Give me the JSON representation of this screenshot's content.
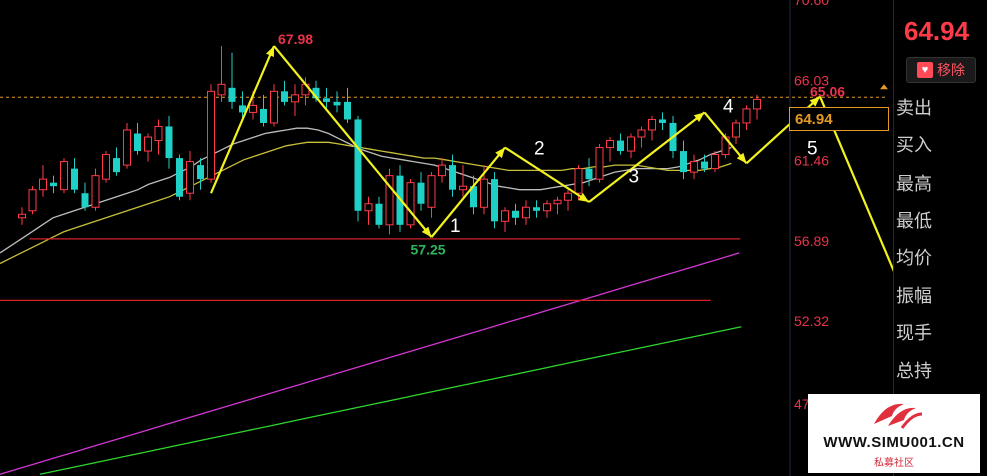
{
  "chart_data": {
    "type": "candlestick",
    "title": "",
    "y_axis_ticks": [
      "70.60",
      "66.03",
      "61.46",
      "56.89",
      "52.32",
      "47"
    ],
    "ylim": [
      43.5,
      70.6
    ],
    "current_price_line": 65.06,
    "candles": [
      {
        "o": 58.2,
        "h": 58.8,
        "l": 57.8,
        "c": 58.4
      },
      {
        "o": 58.6,
        "h": 60.0,
        "l": 58.4,
        "c": 59.8
      },
      {
        "o": 59.8,
        "h": 61.2,
        "l": 59.4,
        "c": 60.4
      },
      {
        "o": 60.2,
        "h": 60.6,
        "l": 59.6,
        "c": 60.0
      },
      {
        "o": 59.8,
        "h": 61.6,
        "l": 59.6,
        "c": 61.4
      },
      {
        "o": 61.0,
        "h": 61.6,
        "l": 59.6,
        "c": 59.8
      },
      {
        "o": 59.6,
        "h": 60.2,
        "l": 58.6,
        "c": 58.8
      },
      {
        "o": 58.8,
        "h": 61.0,
        "l": 58.6,
        "c": 60.6
      },
      {
        "o": 60.4,
        "h": 62.0,
        "l": 60.2,
        "c": 61.8
      },
      {
        "o": 61.6,
        "h": 62.2,
        "l": 60.6,
        "c": 60.8
      },
      {
        "o": 61.2,
        "h": 63.6,
        "l": 61.0,
        "c": 63.2
      },
      {
        "o": 63.0,
        "h": 63.6,
        "l": 61.8,
        "c": 62.0
      },
      {
        "o": 62.0,
        "h": 63.0,
        "l": 61.4,
        "c": 62.8
      },
      {
        "o": 62.6,
        "h": 63.8,
        "l": 61.8,
        "c": 63.4
      },
      {
        "o": 63.4,
        "h": 64.0,
        "l": 61.0,
        "c": 61.6
      },
      {
        "o": 61.6,
        "h": 61.8,
        "l": 59.2,
        "c": 59.4
      },
      {
        "o": 59.6,
        "h": 62.0,
        "l": 59.2,
        "c": 61.4
      },
      {
        "o": 61.2,
        "h": 61.6,
        "l": 59.8,
        "c": 60.4
      },
      {
        "o": 60.4,
        "h": 65.8,
        "l": 60.2,
        "c": 65.4
      },
      {
        "o": 65.2,
        "h": 67.98,
        "l": 64.8,
        "c": 65.8
      },
      {
        "o": 65.6,
        "h": 67.6,
        "l": 64.4,
        "c": 64.8
      },
      {
        "o": 64.6,
        "h": 65.4,
        "l": 63.8,
        "c": 64.2
      },
      {
        "o": 64.2,
        "h": 65.4,
        "l": 63.8,
        "c": 64.6
      },
      {
        "o": 64.4,
        "h": 65.2,
        "l": 63.4,
        "c": 63.6
      },
      {
        "o": 63.6,
        "h": 65.8,
        "l": 63.4,
        "c": 65.4
      },
      {
        "o": 65.4,
        "h": 66.0,
        "l": 64.6,
        "c": 64.8
      },
      {
        "o": 64.8,
        "h": 65.8,
        "l": 64.0,
        "c": 65.2
      },
      {
        "o": 65.2,
        "h": 66.2,
        "l": 64.6,
        "c": 65.8
      },
      {
        "o": 65.6,
        "h": 66.0,
        "l": 64.8,
        "c": 65.0
      },
      {
        "o": 65.0,
        "h": 65.6,
        "l": 64.4,
        "c": 64.8
      },
      {
        "o": 64.8,
        "h": 65.4,
        "l": 64.2,
        "c": 64.6
      },
      {
        "o": 64.8,
        "h": 65.6,
        "l": 63.6,
        "c": 63.8
      },
      {
        "o": 63.8,
        "h": 64.0,
        "l": 58.0,
        "c": 58.6
      },
      {
        "o": 58.6,
        "h": 59.4,
        "l": 57.8,
        "c": 59.0
      },
      {
        "o": 59.0,
        "h": 59.4,
        "l": 57.6,
        "c": 57.8
      },
      {
        "o": 57.8,
        "h": 61.0,
        "l": 57.25,
        "c": 60.6
      },
      {
        "o": 60.6,
        "h": 61.2,
        "l": 57.4,
        "c": 57.8
      },
      {
        "o": 57.8,
        "h": 60.4,
        "l": 57.6,
        "c": 60.2
      },
      {
        "o": 60.2,
        "h": 60.8,
        "l": 58.6,
        "c": 59.0
      },
      {
        "o": 58.8,
        "h": 60.8,
        "l": 58.2,
        "c": 60.6
      },
      {
        "o": 60.6,
        "h": 61.6,
        "l": 60.2,
        "c": 61.2
      },
      {
        "o": 61.2,
        "h": 61.8,
        "l": 59.4,
        "c": 59.8
      },
      {
        "o": 59.8,
        "h": 61.2,
        "l": 59.4,
        "c": 60.0
      },
      {
        "o": 60.0,
        "h": 60.6,
        "l": 58.4,
        "c": 58.8
      },
      {
        "o": 58.8,
        "h": 61.2,
        "l": 58.4,
        "c": 60.4
      },
      {
        "o": 60.4,
        "h": 60.8,
        "l": 57.6,
        "c": 58.0
      },
      {
        "o": 58.0,
        "h": 58.8,
        "l": 57.4,
        "c": 58.6
      },
      {
        "o": 58.6,
        "h": 59.0,
        "l": 57.8,
        "c": 58.2
      },
      {
        "o": 58.2,
        "h": 59.2,
        "l": 57.8,
        "c": 58.8
      },
      {
        "o": 58.8,
        "h": 59.2,
        "l": 58.2,
        "c": 58.6
      },
      {
        "o": 58.6,
        "h": 59.2,
        "l": 58.2,
        "c": 59.0
      },
      {
        "o": 59.0,
        "h": 59.4,
        "l": 58.4,
        "c": 59.2
      },
      {
        "o": 59.2,
        "h": 59.8,
        "l": 58.6,
        "c": 59.6
      },
      {
        "o": 59.6,
        "h": 61.2,
        "l": 59.2,
        "c": 61.0
      },
      {
        "o": 61.0,
        "h": 61.6,
        "l": 60.0,
        "c": 60.4
      },
      {
        "o": 60.4,
        "h": 62.4,
        "l": 60.2,
        "c": 62.2
      },
      {
        "o": 62.2,
        "h": 62.8,
        "l": 61.4,
        "c": 62.6
      },
      {
        "o": 62.6,
        "h": 63.0,
        "l": 61.8,
        "c": 62.0
      },
      {
        "o": 62.0,
        "h": 63.0,
        "l": 61.6,
        "c": 62.8
      },
      {
        "o": 62.8,
        "h": 63.4,
        "l": 62.2,
        "c": 63.2
      },
      {
        "o": 63.2,
        "h": 64.0,
        "l": 62.6,
        "c": 63.8
      },
      {
        "o": 63.8,
        "h": 64.2,
        "l": 63.2,
        "c": 63.6
      },
      {
        "o": 63.6,
        "h": 64.0,
        "l": 61.6,
        "c": 62.0
      },
      {
        "o": 62.0,
        "h": 62.6,
        "l": 60.4,
        "c": 60.8
      },
      {
        "o": 60.8,
        "h": 61.8,
        "l": 60.4,
        "c": 61.4
      },
      {
        "o": 61.4,
        "h": 61.8,
        "l": 60.8,
        "c": 61.0
      },
      {
        "o": 61.0,
        "h": 62.0,
        "l": 60.8,
        "c": 61.8
      },
      {
        "o": 61.8,
        "h": 63.0,
        "l": 61.6,
        "c": 62.8
      },
      {
        "o": 62.8,
        "h": 63.8,
        "l": 62.4,
        "c": 63.6
      },
      {
        "o": 63.6,
        "h": 64.6,
        "l": 63.2,
        "c": 64.4
      },
      {
        "o": 64.4,
        "h": 65.2,
        "l": 63.8,
        "c": 64.94
      }
    ],
    "ma_white": [
      56.2,
      56.6,
      57.0,
      57.4,
      57.8,
      58.2,
      58.4,
      58.6,
      58.8,
      59.0,
      59.2,
      59.4,
      59.6,
      59.8,
      60.1,
      60.3,
      60.5,
      60.8,
      61.1,
      61.5,
      61.8,
      62.1,
      62.4,
      62.6,
      62.8,
      63.0,
      63.1,
      63.2,
      63.3,
      63.3,
      63.2,
      63.0,
      62.7,
      62.4,
      62.1,
      61.9,
      61.7,
      61.6,
      61.5,
      61.4,
      61.3,
      61.2,
      61.0,
      60.8,
      60.6,
      60.4,
      60.2,
      60.0,
      59.9,
      59.8,
      59.8,
      59.8,
      59.9,
      60.0,
      60.1,
      60.2,
      60.4,
      60.6,
      60.8,
      60.9,
      61.0,
      61.0,
      61.0,
      61.0,
      61.1,
      61.3,
      61.5,
      61.8,
      62.0,
      62.2
    ],
    "ma_yellow": [
      55.6,
      55.9,
      56.2,
      56.5,
      56.8,
      57.1,
      57.4,
      57.6,
      57.8,
      58.0,
      58.2,
      58.4,
      58.6,
      58.8,
      59.0,
      59.2,
      59.4,
      59.7,
      60.0,
      60.3,
      60.6,
      60.9,
      61.2,
      61.5,
      61.7,
      61.9,
      62.1,
      62.3,
      62.4,
      62.5,
      62.5,
      62.5,
      62.4,
      62.3,
      62.2,
      62.1,
      62.0,
      61.9,
      61.8,
      61.7,
      61.6,
      61.6,
      61.5,
      61.4,
      61.3,
      61.2,
      61.1,
      61.0,
      60.9,
      60.9,
      60.9,
      60.9,
      60.9,
      60.9,
      61.0,
      61.0,
      61.1,
      61.1,
      61.2,
      61.2,
      61.2,
      61.1,
      61.0,
      60.9,
      60.9,
      60.9,
      60.9,
      61.0,
      61.1,
      61.3
    ],
    "ma_magenta": [
      43.6,
      43.9,
      44.2,
      44.5,
      44.8,
      45.1,
      45.4,
      45.7,
      46.0,
      46.3,
      46.6,
      46.9,
      47.2,
      47.5,
      47.8,
      48.1,
      48.4,
      48.7,
      49.0,
      49.3,
      49.6,
      49.9,
      50.2,
      50.5,
      50.8,
      51.1,
      51.4,
      51.7,
      52.0,
      52.3,
      52.6,
      52.9,
      53.2,
      53.5,
      53.8,
      54.1,
      54.4,
      54.7,
      55.0,
      55.3,
      55.6,
      55.9,
      56.2
    ],
    "ma_green": [
      43.6,
      44.0,
      44.4,
      44.8,
      45.2,
      45.6,
      46.0,
      46.4,
      46.8,
      47.2,
      47.6,
      48.0,
      48.4,
      48.8,
      49.2,
      49.6,
      50.0,
      50.4,
      50.8,
      51.2,
      51.6,
      52.0
    ],
    "horizontal_lines": [
      {
        "color": "#d6212a",
        "value": 57.0,
        "from": 0.03,
        "to": 0.75
      },
      {
        "color": "#d6212a",
        "value": 53.5,
        "from": 0.0,
        "to": 0.72
      }
    ],
    "annotations": {
      "high_label": "67.98",
      "low_label": "57.25",
      "right_label": "65.06",
      "wave_labels": [
        "1",
        "2",
        "3",
        "4",
        "5"
      ]
    },
    "wave_points": [
      {
        "i": 18,
        "p": 59.6
      },
      {
        "i": 24,
        "p": 67.98
      },
      {
        "i": 39,
        "p": 57.1
      },
      {
        "i": 46,
        "p": 62.2
      },
      {
        "i": 54,
        "p": 59.1
      },
      {
        "i": 65,
        "p": 64.2
      },
      {
        "i": 69,
        "p": 61.3
      },
      {
        "i": 76,
        "p": 65.1
      },
      {
        "i": 84,
        "p": 53.8
      }
    ],
    "colors": {
      "up": "#ff3b4a",
      "down": "#1fd0c6",
      "bg": "#000000",
      "ma_white": "#bdbdbd",
      "ma_yellow": "#c9bf3a",
      "ma_magenta": "#d237d2",
      "ma_green": "#2ed62e",
      "wave_arrow": "#f2f21e",
      "price_dash": "#e39b25"
    }
  },
  "side": {
    "last_price": "64.94",
    "remove_label": "移除",
    "price_box": "64.94",
    "menu": [
      "卖出",
      "买入",
      "最高",
      "最低",
      "均价",
      "振幅",
      "现手",
      "总持"
    ]
  },
  "logo": {
    "site": "WWW.SIMU001.CN",
    "sub": "私募社区"
  }
}
